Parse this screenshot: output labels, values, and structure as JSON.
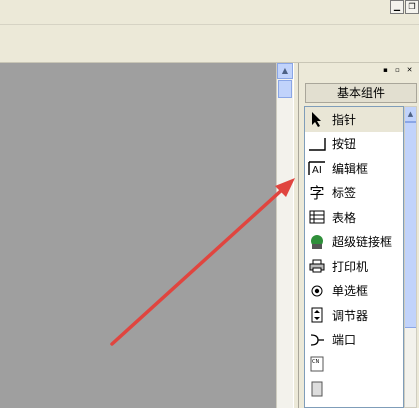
{
  "window": {
    "controls": [
      "minimize-icon",
      "restore-icon"
    ]
  },
  "panel": {
    "header": "基本组件",
    "items": [
      {
        "label": "指针",
        "icon": "pointer-icon"
      },
      {
        "label": "按钮",
        "icon": "button-icon"
      },
      {
        "label": "编辑框",
        "icon": "editbox-icon"
      },
      {
        "label": "标签",
        "icon": "label-icon"
      },
      {
        "label": "表格",
        "icon": "table-icon"
      },
      {
        "label": "超级链接框",
        "icon": "hyperlink-icon"
      },
      {
        "label": "打印机",
        "icon": "printer-icon"
      },
      {
        "label": "单选框",
        "icon": "radio-icon"
      },
      {
        "label": "调节器",
        "icon": "spinner-icon"
      },
      {
        "label": "端口",
        "icon": "port-icon"
      },
      {
        "label": "",
        "icon": "ime-icon"
      },
      {
        "label": "",
        "icon": "server-icon"
      },
      {
        "label": "",
        "icon": "scroll-icon"
      }
    ]
  },
  "annotation": {
    "color": "#e0453f"
  }
}
